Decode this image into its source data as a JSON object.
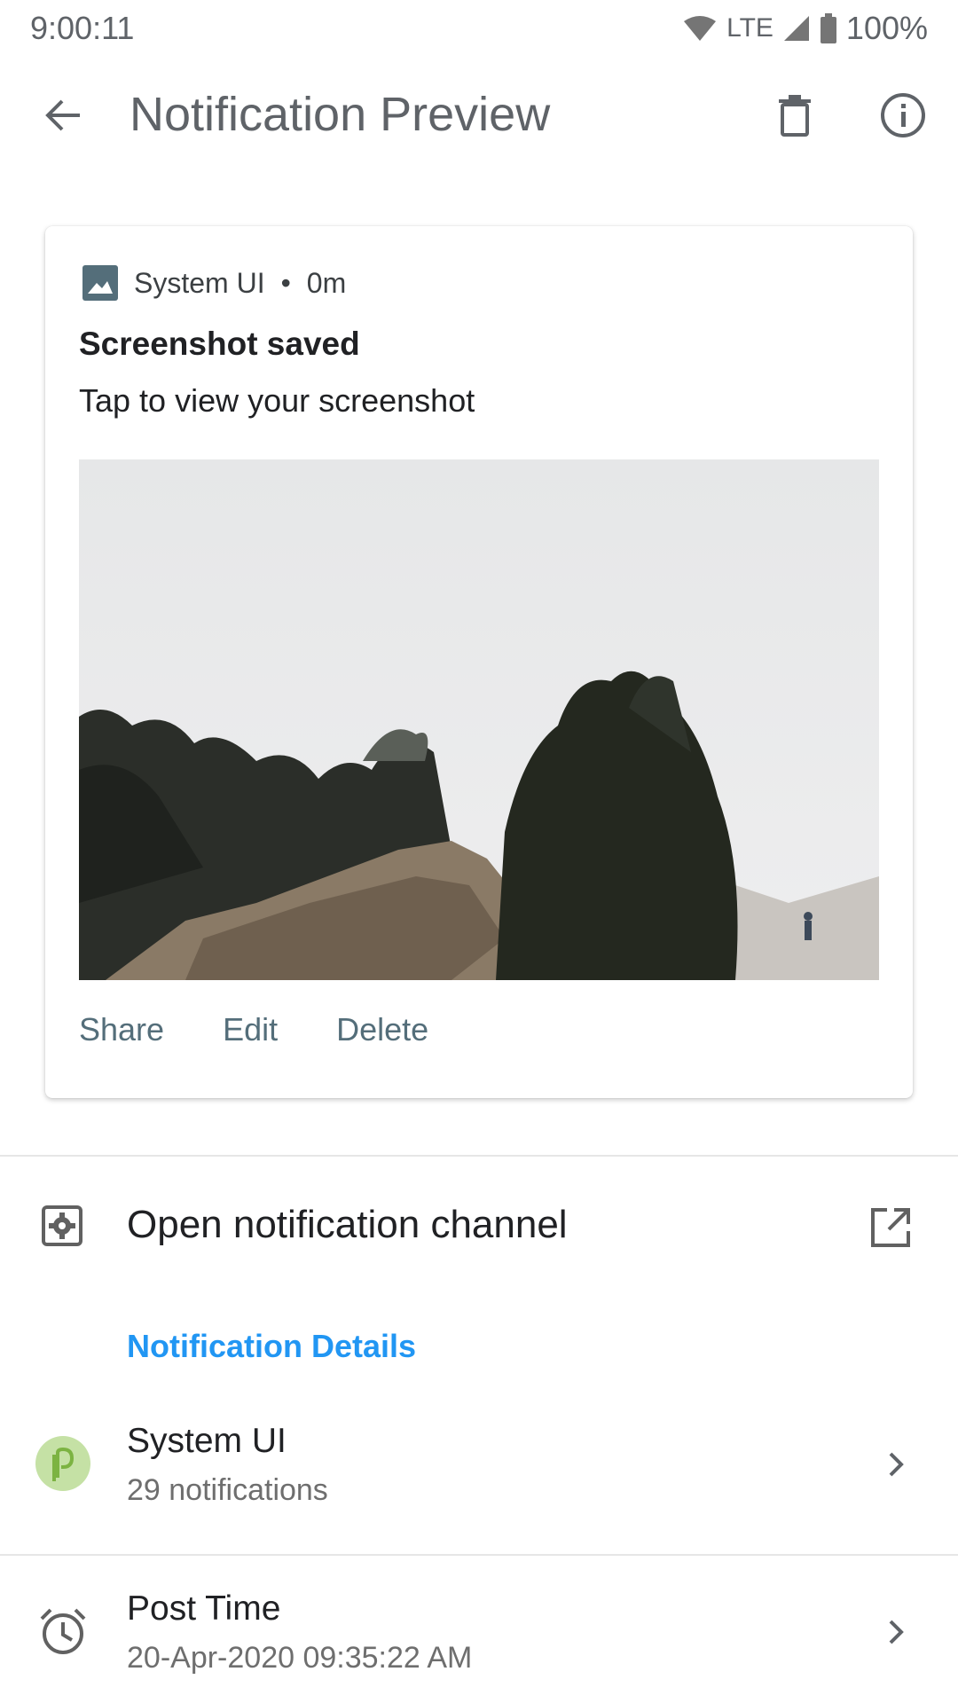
{
  "status_bar": {
    "time": "9:00:11",
    "network": "LTE",
    "battery": "100%"
  },
  "toolbar": {
    "title": "Notification Preview"
  },
  "notification": {
    "app_name": "System UI",
    "age": "0m",
    "separator": "•",
    "title": "Screenshot saved",
    "text": "Tap to view your screenshot",
    "actions": [
      "Share",
      "Edit",
      "Delete"
    ]
  },
  "channel": {
    "label": "Open notification channel"
  },
  "details": {
    "section_title": "Notification Details",
    "app": {
      "title": "System UI",
      "subtitle": "29 notifications"
    },
    "post_time": {
      "title": "Post Time",
      "subtitle": "20-Apr-2020 09:35:22 AM"
    }
  },
  "colors": {
    "accent": "#2196f3",
    "action_text": "#546e7a",
    "app_icon_bg": "#c5e1a5",
    "app_icon_fg": "#7cb342"
  }
}
